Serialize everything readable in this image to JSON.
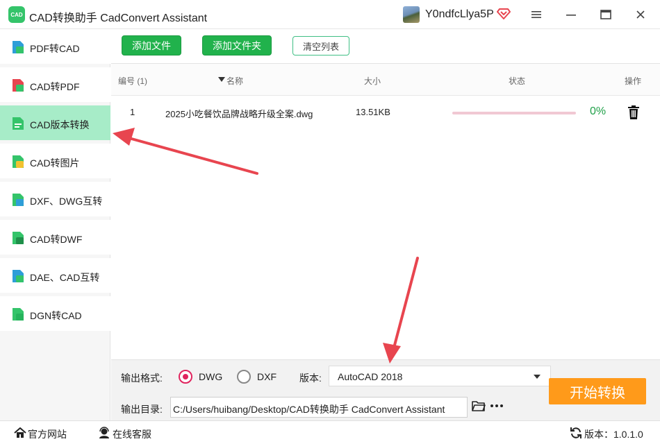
{
  "window": {
    "logo_text": "CAD",
    "title": "CAD转换助手 CadConvert Assistant",
    "username": "Y0ndfcLlya5P"
  },
  "sidebar": {
    "items": [
      {
        "label": "PDF转CAD",
        "icon": "pdf-to-cad-icon",
        "active": false
      },
      {
        "label": "CAD转PDF",
        "icon": "cad-to-pdf-icon",
        "active": false
      },
      {
        "label": "CAD版本转换",
        "icon": "cad-version-icon",
        "active": true
      },
      {
        "label": "CAD转图片",
        "icon": "cad-to-image-icon",
        "active": false
      },
      {
        "label": "DXF、DWG互转",
        "icon": "dxf-dwg-icon",
        "active": false
      },
      {
        "label": "CAD转DWF",
        "icon": "cad-to-dwf-icon",
        "active": false
      },
      {
        "label": "DAE、CAD互转",
        "icon": "dae-cad-icon",
        "active": false
      },
      {
        "label": "DGN转CAD",
        "icon": "dgn-to-cad-icon",
        "active": false
      }
    ]
  },
  "toolbar": {
    "add_file": "添加文件",
    "add_folder": "添加文件夹",
    "clear_list": "清空列表"
  },
  "table": {
    "headers": {
      "index": "编号 (1)",
      "name": "名称",
      "size": "大小",
      "status": "状态",
      "action": "操作"
    },
    "rows": [
      {
        "index": "1",
        "name": "2025小吃餐饮品牌战略升级全案.dwg",
        "size": "13.51KB",
        "progress": 0,
        "percent": "0%"
      }
    ]
  },
  "settings": {
    "format_label": "输出格式:",
    "format_options": [
      "DWG",
      "DXF"
    ],
    "format_selected": "DWG",
    "version_label": "版本:",
    "version_value": "AutoCAD 2018",
    "dir_label": "输出目录:",
    "dir_value": "C:/Users/huibang/Desktop/CAD转换助手 CadConvert Assistant",
    "start_button": "开始转换"
  },
  "statusbar": {
    "website": "官方网站",
    "support": "在线客服",
    "version": "版本：1.0.1.0"
  },
  "colors": {
    "green": "#21b24c",
    "active_nav": "#a7ecc8",
    "orange": "#ff9a1a",
    "arrow": "#e8454f"
  }
}
